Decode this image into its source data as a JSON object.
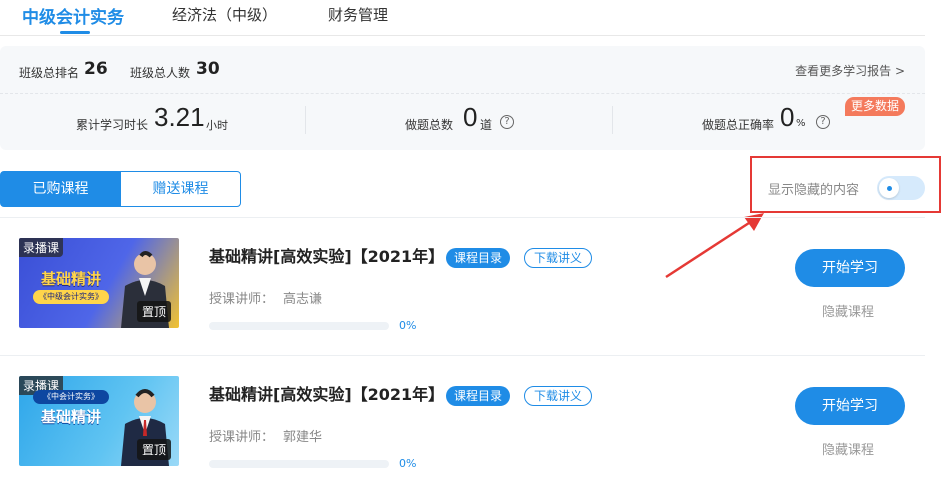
{
  "tabs": [
    {
      "label": "中级会计实务",
      "active": true
    },
    {
      "label": "经济法（中级）",
      "active": false
    },
    {
      "label": "财务管理",
      "active": false
    }
  ],
  "stats": {
    "rank_label": "班级总排名",
    "rank_value": "26",
    "total_label": "班级总人数",
    "total_value": "30",
    "report_link": "查看更多学习报告 >",
    "study_time_label": "累计学习时长",
    "study_time_value": "3.21",
    "study_time_unit": "小时",
    "questions_label": "做题总数",
    "questions_value": "0",
    "questions_unit": "道",
    "accuracy_label": "做题总正确率",
    "accuracy_value": "0",
    "accuracy_unit": "%",
    "more_data": "更多数据",
    "help_glyph": "?"
  },
  "segment": {
    "purchased": "已购课程",
    "gifted": "赠送课程"
  },
  "hidden_toggle": {
    "label": "显示隐藏的内容",
    "on": false
  },
  "colors": {
    "accent": "#1f8ce6",
    "highlight_border": "#e53935",
    "badge": "#f47a5c"
  },
  "courses": [
    {
      "title": "基础精讲[高效实验]【2021年】",
      "catalog_label": "课程目录",
      "download_label": "下载讲义",
      "teacher_label": "授课讲师：",
      "teacher": "高志谦",
      "progress": 0,
      "progress_text": "0%",
      "start_label": "开始学习",
      "hide_label": "隐藏课程",
      "thumb_badge": "录播课",
      "thumb_pin": "置顶",
      "thumb_title": "基础精讲",
      "thumb_sub": "《中级会计实务》"
    },
    {
      "title": "基础精讲[高效实验]【2021年】",
      "catalog_label": "课程目录",
      "download_label": "下载讲义",
      "teacher_label": "授课讲师：",
      "teacher": "郭建华",
      "progress": 0,
      "progress_text": "0%",
      "start_label": "开始学习",
      "hide_label": "隐藏课程",
      "thumb_badge": "录播课",
      "thumb_pin": "置顶",
      "thumb_title": "基础精讲",
      "thumb_sub": "《中会计实务》"
    }
  ]
}
